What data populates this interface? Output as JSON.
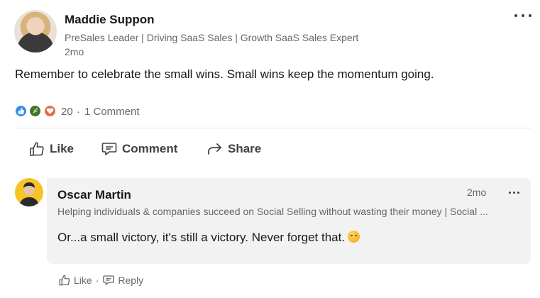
{
  "post": {
    "author_name": "Maddie Suppon",
    "author_headline": "PreSales Leader | Driving SaaS Sales | Growth SaaS Sales Expert",
    "time": "2mo",
    "text": "Remember to celebrate the small wins. Small wins keep the momentum going.",
    "reaction_count": "20",
    "separator": "·",
    "comment_count": "1 Comment",
    "reactions": [
      "like-icon",
      "celebrate-icon",
      "love-icon"
    ]
  },
  "actions": {
    "like_label": "Like",
    "comment_label": "Comment",
    "share_label": "Share"
  },
  "comment": {
    "author_name": "Oscar Martin",
    "time": "2mo",
    "headline": "Helping individuals & companies succeed on Social Selling without wasting their money | Social ...",
    "text": "Or...a small victory, it's still a victory. Never forget that.",
    "emoji": "smiling-face-icon",
    "like_label": "Like",
    "separator": "·",
    "reply_label": "Reply"
  },
  "colors": {
    "like": "#378fe9",
    "celebrate": "#44712e",
    "love": "#df704d",
    "comment_bg": "#f2f2f2",
    "avatar_comment_bg": "#f7c325"
  }
}
